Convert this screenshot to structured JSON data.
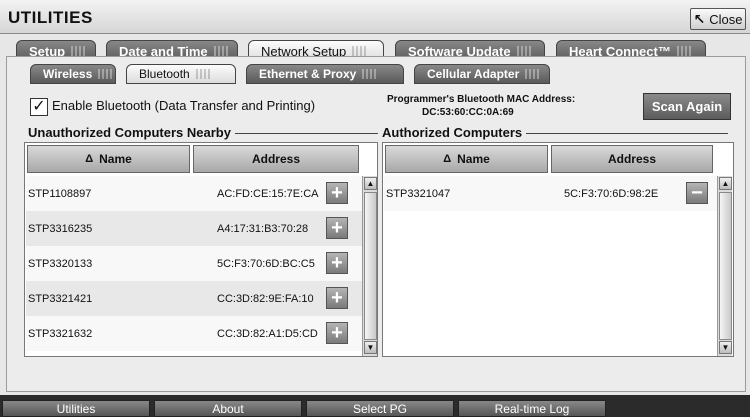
{
  "window": {
    "title": "UTILITIES",
    "close_label": "Close"
  },
  "main_tabs": [
    {
      "label": "Setup"
    },
    {
      "label": "Date and Time"
    },
    {
      "label": "Network Setup"
    },
    {
      "label": "Software Update"
    },
    {
      "label": "Heart Connect™"
    }
  ],
  "sub_tabs": [
    {
      "label": "Wireless"
    },
    {
      "label": "Bluetooth"
    },
    {
      "label": "Ethernet & Proxy"
    },
    {
      "label": "Cellular Adapter"
    }
  ],
  "bluetooth": {
    "enable_label": "Enable Bluetooth (Data Transfer and Printing)",
    "enabled": true,
    "check_mark": "✓",
    "mac_label": "Programmer's Bluetooth MAC Address:",
    "mac_value": "DC:53:60:CC:0A:69",
    "scan_label": "Scan Again"
  },
  "unauthorized": {
    "title": "Unauthorized Computers Nearby",
    "col_name": "Name",
    "col_address": "Address",
    "sort_glyph": "Δ",
    "add_glyph": "+",
    "rows": [
      {
        "name": "STP1108897",
        "address": "AC:FD:CE:15:7E:CA"
      },
      {
        "name": "STP3316235",
        "address": "A4:17:31:B3:70:28"
      },
      {
        "name": "STP3320133",
        "address": "5C:F3:70:6D:BC:C5"
      },
      {
        "name": "STP3321421",
        "address": "CC:3D:82:9E:FA:10"
      },
      {
        "name": "STP3321632",
        "address": "CC:3D:82:A1:D5:CD"
      }
    ]
  },
  "authorized": {
    "title": "Authorized Computers",
    "col_name": "Name",
    "col_address": "Address",
    "sort_glyph": "Δ",
    "remove_glyph": "−",
    "rows": [
      {
        "name": "STP3321047",
        "address": "5C:F3:70:6D:98:2E"
      }
    ]
  },
  "bottom_nav": [
    {
      "label": "Utilities"
    },
    {
      "label": "About"
    },
    {
      "label": "Select PG"
    },
    {
      "label": "Real-time Log"
    }
  ],
  "colors": {
    "tab_dark": "#6e6e6e",
    "panel_bg": "#ececec",
    "bottom_bar": "#2b2b2b"
  }
}
